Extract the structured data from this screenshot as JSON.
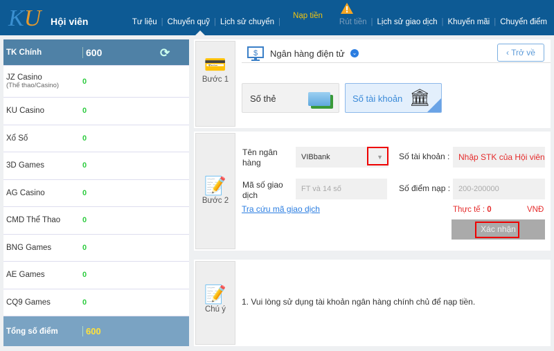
{
  "header": {
    "logo": "KU",
    "title": "Hội viên",
    "nav": [
      {
        "label": "Tư liệu"
      },
      {
        "label": "Chuyển quỹ"
      },
      {
        "label": "Lịch sử chuyển"
      },
      {
        "label": "Nạp tiền",
        "active": true
      },
      {
        "label": "Rút tiền",
        "disabled": true,
        "warning": true
      },
      {
        "label": "Lịch sử giao dịch"
      },
      {
        "label": "Khuyến mãi"
      },
      {
        "label": "Chuyển điểm"
      }
    ]
  },
  "sidebar": {
    "main": {
      "label": "TK Chính",
      "value": "600"
    },
    "items": [
      {
        "label": "JZ Casino",
        "sub": "(Thể thao/Casino)",
        "value": "0"
      },
      {
        "label": "KU Casino",
        "value": "0"
      },
      {
        "label": "Xổ Số",
        "value": "0"
      },
      {
        "label": "3D Games",
        "value": "0"
      },
      {
        "label": "AG Casino",
        "value": "0"
      },
      {
        "label": "CMD Thể Thao",
        "value": "0"
      },
      {
        "label": "BNG Games",
        "value": "0"
      },
      {
        "label": "AE Games",
        "value": "0"
      },
      {
        "label": "CQ9 Games",
        "value": "0"
      }
    ],
    "total": {
      "label": "Tổng số điểm",
      "value": "600"
    }
  },
  "step1": {
    "label": "Bước 1",
    "method": "Ngân hàng điện tử",
    "back": "Trở về",
    "options": [
      {
        "label": "Số thẻ"
      },
      {
        "label": "Số tài khoản",
        "selected": true
      }
    ]
  },
  "step2": {
    "label": "Bước 2",
    "bank_label": "Tên ngân hàng",
    "bank_value": "VIBbank",
    "txn_label": "Mã số giao dịch",
    "txn_placeholder": "FT và 14 số",
    "lookup_link": "Tra cứu mã giao dịch",
    "account_label": "Số tài khoản :",
    "account_placeholder": "Nhập STK của Hội viên",
    "points_label": "Số điểm nạp :",
    "points_placeholder": "200-200000",
    "actual_label": "Thực tế :",
    "actual_value": "0",
    "currency": "VNĐ",
    "confirm": "Xác nhận"
  },
  "step3": {
    "label": "Chú ý",
    "note": "1.  Vui lòng sử dụng tài khoản ngân hàng chính chủ để nạp tiền."
  }
}
